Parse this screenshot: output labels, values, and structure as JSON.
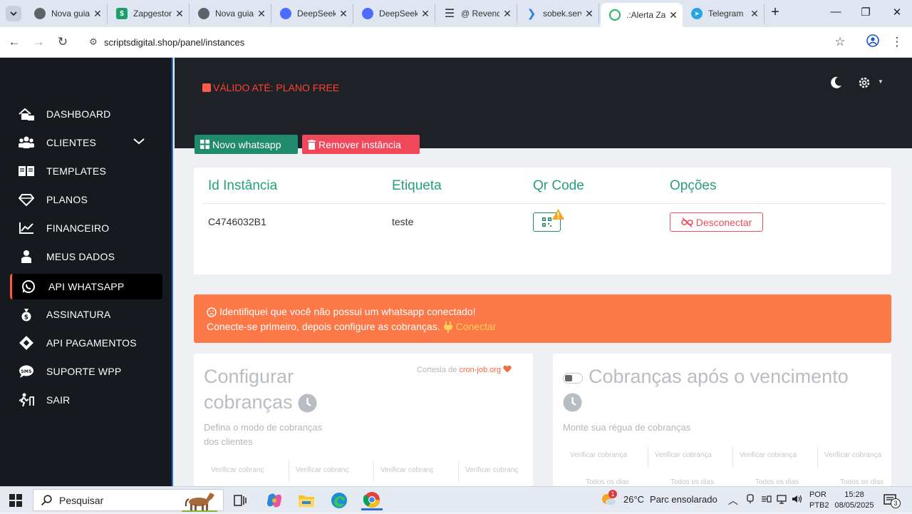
{
  "browser": {
    "tabs": [
      {
        "title": "Nova guia",
        "favicon": "chrome-icon",
        "color": "#5f6368",
        "active": false
      },
      {
        "title": "Zapgestor",
        "favicon": "zapgestor-icon",
        "color": "#1e9e6b",
        "active": false
      },
      {
        "title": "Nova guia",
        "favicon": "chrome-icon",
        "color": "#5f6368",
        "active": false
      },
      {
        "title": "DeepSeek",
        "favicon": "deepseek-icon",
        "color": "#4d6bfe",
        "active": false
      },
      {
        "title": "DeepSeek",
        "favicon": "deepseek-icon",
        "color": "#4d6bfe",
        "active": false
      },
      {
        "title": "@ Revenda",
        "favicon": "menu-icon",
        "color": "#333333",
        "active": false
      },
      {
        "title": "sobek.server",
        "favicon": "sobek-icon",
        "color": "#2a7de1",
        "active": false
      },
      {
        "title": ".:Alerta Zap",
        "favicon": "alertazap-icon",
        "color": "#22b35e",
        "active": true
      },
      {
        "title": "Telegram",
        "favicon": "telegram-icon",
        "color": "#2aa3df",
        "active": false
      }
    ],
    "url": "scriptsdigital.shop/panel/instances"
  },
  "sidebar": {
    "items": [
      {
        "label": "DASHBOARD",
        "icon": "home-icon"
      },
      {
        "label": "CLIENTES",
        "icon": "users-icon"
      },
      {
        "label": "TEMPLATES",
        "icon": "book-icon"
      },
      {
        "label": "PLANOS",
        "icon": "gem-icon"
      },
      {
        "label": "FINANCEIRO",
        "icon": "chart-line-icon"
      },
      {
        "label": "MEUS DADOS",
        "icon": "user-icon"
      },
      {
        "label": "API WHATSAPP",
        "icon": "whatsapp-icon"
      },
      {
        "label": "ASSINATURA",
        "icon": "money-bag-icon"
      },
      {
        "label": "API PAGAMENTOS",
        "icon": "payments-icon"
      },
      {
        "label": "SUPORTE WPP",
        "icon": "sms-icon"
      },
      {
        "label": "SAIR",
        "icon": "exit-icon"
      }
    ],
    "active": "API WHATSAPP"
  },
  "header": {
    "valid_label": "VÁLIDO ATÉ: PLANO FREE"
  },
  "actions": {
    "new_label": "Novo whatsapp",
    "remove_label": "Remover instância"
  },
  "instances": {
    "columns": [
      "Id Instância",
      "Etiqueta",
      "Qr Code",
      "Opções"
    ],
    "rows": [
      {
        "id": "C4746032B1",
        "label": "teste",
        "disconnect_label": "Desconectar"
      }
    ]
  },
  "alert": {
    "line1": "Identifiquei que você não possui um whatsapp conectado!",
    "line2": "Conecte-se primeiro, depois configure as cobranças.",
    "link": "Conectar"
  },
  "card_config": {
    "title_line1": "Configurar",
    "title_line2": "cobranças",
    "subtitle_line1": "Defina o modo de cobranças",
    "subtitle_line2": "dos clientes",
    "courtesy_prefix": "Cortesia de",
    "courtesy_link": "cron-job.org",
    "columns": [
      "Verificar cobranç",
      "Verificar cobranç",
      "Verificar cobranç",
      "Verificar cobranç"
    ]
  },
  "card_overdue": {
    "title": "Cobranças após o vencimento",
    "subtitle": "Monte sua régua de cobranças",
    "columns": [
      "Verificar cobrança",
      "Verificar cobrança",
      "Verificar cobrança",
      "Verificar cobrança"
    ],
    "sub_columns": [
      "Todos os dias",
      "Todos os dias",
      "Todos os dias",
      "Todos os dias"
    ]
  },
  "taskbar": {
    "search_placeholder": "Pesquisar",
    "weather_temp": "26°C",
    "weather_desc": "Parc ensolarado",
    "weather_badge": "1",
    "lang_line1": "POR",
    "lang_line2": "PTB2",
    "time": "15:28",
    "date": "08/05/2025",
    "notification_count": "3"
  },
  "colors": {
    "accent_green": "#1f8a6c",
    "danger": "#f0485a",
    "alert": "#fc7848",
    "sidebar_bg": "#16191e"
  }
}
